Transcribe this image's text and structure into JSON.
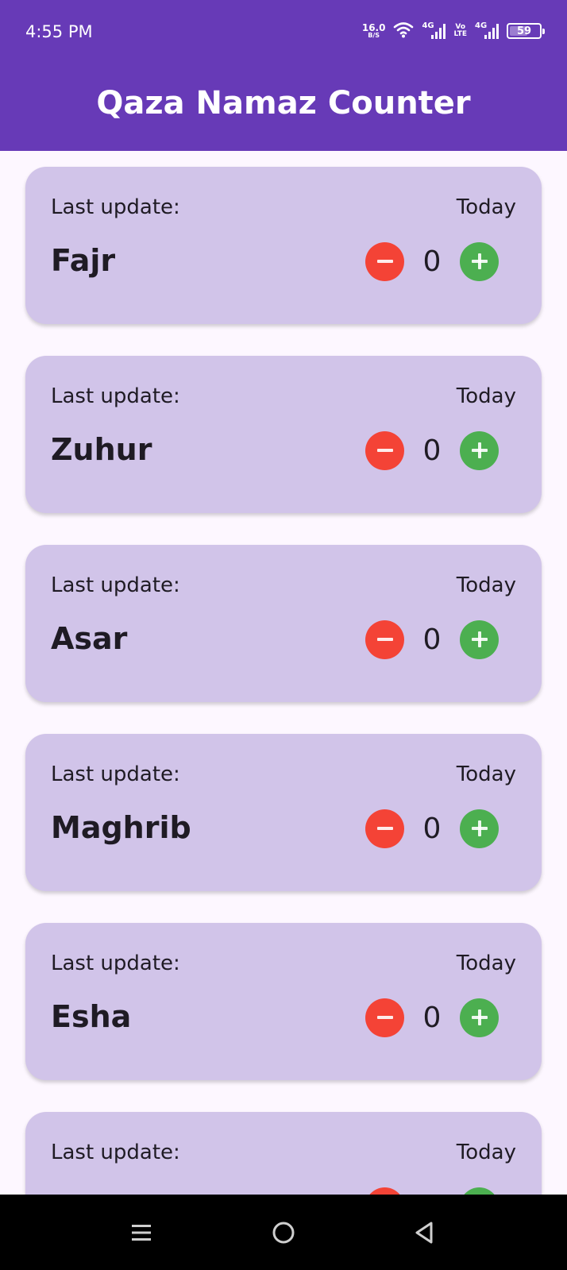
{
  "status_bar": {
    "time": "4:55 PM",
    "net_speed_value": "16.0",
    "net_speed_unit": "B/S",
    "signal1_label": "4G",
    "volte_top": "Vo",
    "volte_bottom": "LTE",
    "signal2_label": "4G",
    "battery_level": "59"
  },
  "app_bar": {
    "title": "Qaza Namaz Counter"
  },
  "cards": [
    {
      "last_update_label": "Last update:",
      "date": "Today",
      "name": "Fajr",
      "count": "0"
    },
    {
      "last_update_label": "Last update:",
      "date": "Today",
      "name": "Zuhur",
      "count": "0"
    },
    {
      "last_update_label": "Last update:",
      "date": "Today",
      "name": "Asar",
      "count": "0"
    },
    {
      "last_update_label": "Last update:",
      "date": "Today",
      "name": "Maghrib",
      "count": "0"
    },
    {
      "last_update_label": "Last update:",
      "date": "Today",
      "name": "Esha",
      "count": "0"
    },
    {
      "last_update_label": "Last update:",
      "date": "Today",
      "name": "",
      "count": ""
    }
  ],
  "colors": {
    "primary": "#673AB7",
    "card": "#D1C4E9",
    "background": "#FDF7FF",
    "decrement": "#F44336",
    "increment": "#4CAF50"
  },
  "icons": {
    "decrement": "minus-icon",
    "increment": "plus-icon",
    "nav_recents": "menu-icon",
    "nav_home": "circle-home-icon",
    "nav_back": "triangle-back-icon"
  }
}
